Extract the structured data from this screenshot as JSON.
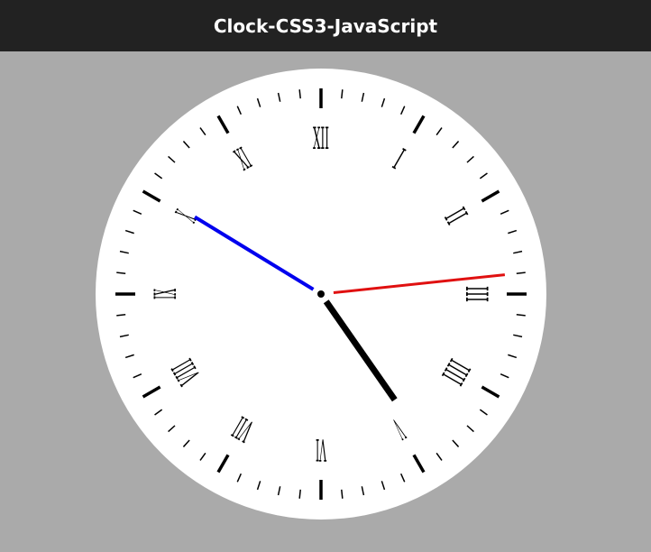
{
  "header": {
    "title": "Clock-CSS3-JavaScript"
  },
  "clock": {
    "numerals": [
      "XII",
      "I",
      "II",
      "III",
      "IIII",
      "V",
      "VI",
      "VII",
      "VIII",
      "IX",
      "X",
      "XI"
    ],
    "time": {
      "hours": 4,
      "minutes": 50,
      "seconds": 14
    },
    "colors": {
      "background": "#aaaaaa",
      "header": "#222222",
      "face": "#ffffff",
      "hour_hand": "#000000",
      "minute_hand": "#0000ee",
      "second_hand": "#e01010"
    }
  }
}
